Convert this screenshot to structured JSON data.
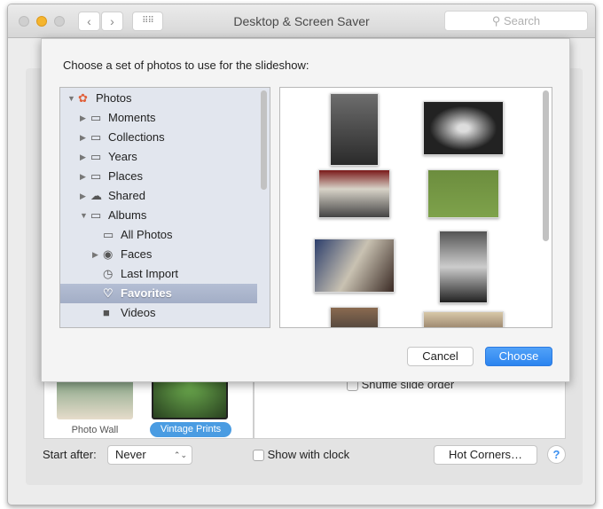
{
  "window": {
    "title": "Desktop & Screen Saver",
    "search_placeholder": "Search"
  },
  "sheet": {
    "prompt": "Choose a set of photos to use for the slideshow:",
    "tree": [
      {
        "label": "Photos",
        "icon": "photos-app-icon",
        "expanded": true,
        "level": 0
      },
      {
        "label": "Moments",
        "icon": "folder-icon",
        "expanded": false,
        "level": 1
      },
      {
        "label": "Collections",
        "icon": "folder-icon",
        "expanded": false,
        "level": 1
      },
      {
        "label": "Years",
        "icon": "folder-icon",
        "expanded": false,
        "level": 1
      },
      {
        "label": "Places",
        "icon": "folder-icon",
        "expanded": false,
        "level": 1
      },
      {
        "label": "Shared",
        "icon": "cloud-icon",
        "expanded": false,
        "level": 1
      },
      {
        "label": "Albums",
        "icon": "folder-icon",
        "expanded": true,
        "level": 1
      },
      {
        "label": "All Photos",
        "icon": "album-icon",
        "level": 2
      },
      {
        "label": "Faces",
        "icon": "face-icon",
        "expanded": false,
        "level": 2
      },
      {
        "label": "Last Import",
        "icon": "clock-icon",
        "level": 2
      },
      {
        "label": "Favorites",
        "icon": "heart-icon",
        "level": 2,
        "selected": true
      },
      {
        "label": "Videos",
        "icon": "video-icon",
        "level": 2
      }
    ],
    "cancel": "Cancel",
    "choose": "Choose"
  },
  "background": {
    "thumbs": [
      {
        "label": "Photo Wall"
      },
      {
        "label": "Vintage Prints",
        "selected": true
      }
    ],
    "shuffle": "Shuffle slide order",
    "start_after_label": "Start after:",
    "start_after_value": "Never",
    "show_clock": "Show with clock",
    "hot_corners": "Hot Corners…",
    "help": "?"
  },
  "colors": {
    "accent": "#3b8ff0",
    "selection": "#a8b3ca"
  }
}
